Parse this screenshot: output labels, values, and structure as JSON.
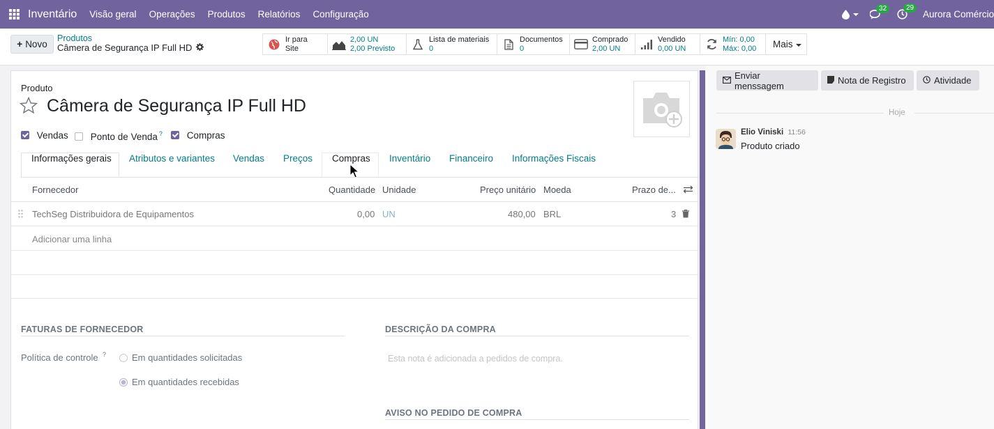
{
  "navbar": {
    "app_name": "Inventário",
    "menu": [
      "Visão geral",
      "Operações",
      "Produtos",
      "Relatórios",
      "Configuração"
    ],
    "messages_count": "32",
    "activities_count": "29",
    "company": "Aurora Comércio"
  },
  "control_panel": {
    "new_button": "Novo",
    "breadcrumb_parent": "Produtos",
    "breadcrumb_current": "Câmera de Segurança IP Full HD",
    "smart_buttons": [
      {
        "line1": "Ir para",
        "line2": "Site",
        "icon": "globe-icon"
      },
      {
        "line1": "2,00 UN",
        "line2": "2,00",
        "line2b": "Previsto",
        "icon": "area-chart-icon"
      },
      {
        "line1": "Lista de materiais",
        "line2": "0",
        "icon": "flask-icon"
      },
      {
        "line1": "Documentos",
        "line2": "0",
        "icon": "file-icon"
      },
      {
        "line1": "Comprado",
        "line2": "2,00 UN",
        "icon": "credit-card-icon"
      },
      {
        "line1": "Vendido",
        "line2": "0,00 UN",
        "icon": "signal-icon"
      },
      {
        "line1": "Mín: 0,00",
        "line2": "Máx: 0,00",
        "icon": "refresh-icon"
      }
    ],
    "more_button": "Mais"
  },
  "form": {
    "label": "Produto",
    "name": "Câmera de Segurança IP Full HD",
    "checkboxes": [
      {
        "label": "Vendas",
        "checked": true
      },
      {
        "label": "Ponto de Venda",
        "checked": false,
        "help": "?"
      },
      {
        "label": "Compras",
        "checked": true
      }
    ],
    "tabs": [
      "Informações gerais",
      "Atributos e variantes",
      "Vendas",
      "Preços",
      "Compras",
      "Inventário",
      "Financeiro",
      "Informações Fiscais"
    ],
    "active_tab": "Informações gerais",
    "table": {
      "headers": [
        "Fornecedor",
        "Quantidade",
        "Unidade",
        "Preço unitário",
        "Moeda",
        "Prazo de..."
      ],
      "rows": [
        {
          "vendor": "TechSeg Distribuidora de Equipamentos",
          "qty": "0,00",
          "uom": "UN",
          "price": "480,00",
          "currency": "BRL",
          "delay": "3"
        }
      ],
      "add_line": "Adicionar uma linha"
    },
    "vendor_bills_title": "FATURAS DE FORNECEDOR",
    "control_policy_label": "Política de controle",
    "control_policy_help": "?",
    "control_policy_options": [
      {
        "label": "Em quantidades solicitadas",
        "selected": false
      },
      {
        "label": "Em quantidades recebidas",
        "selected": true
      }
    ],
    "purchase_desc_title": "DESCRIÇÃO DA COMPRA",
    "purchase_desc_placeholder": "Esta nota é adicionada a pedidos de compra.",
    "po_warning_title": "AVISO NO PEDIDO DE COMPRA"
  },
  "chatter": {
    "send_message": "Enviar menssagem",
    "log_note": "Nota de Registro",
    "activity": "Atividade",
    "date_separator": "Hoje",
    "messages": [
      {
        "author": "Elio Viniski",
        "time": "11:56",
        "body": "Produto criado"
      }
    ]
  },
  "colors": {
    "navbar": "#71639e",
    "link": "#017e84",
    "badge": "#28a745"
  }
}
